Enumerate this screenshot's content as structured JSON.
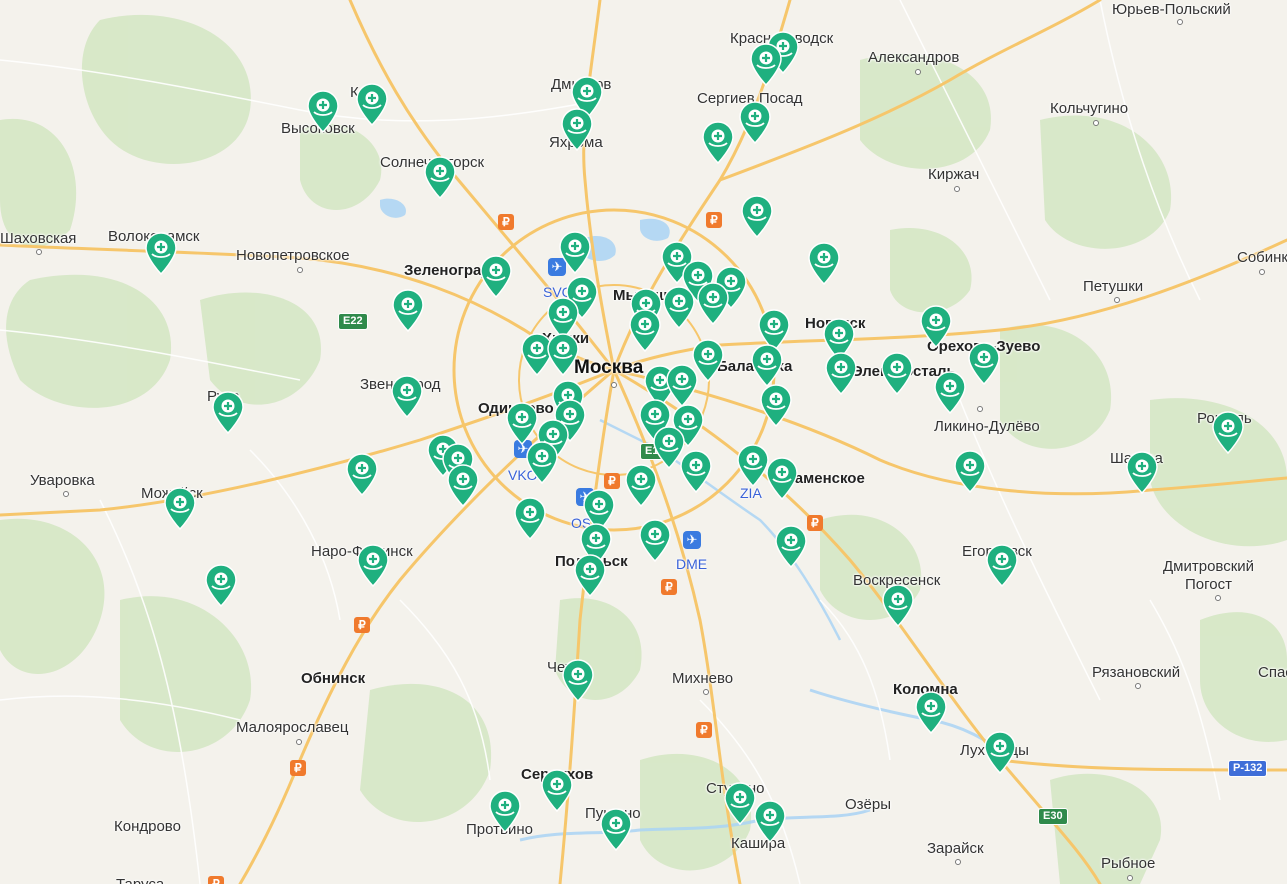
{
  "map": {
    "region": "Московская область",
    "colors": {
      "background": "#f4f2ec",
      "forest": "#d8e9c8",
      "road_major": "#f6c66b",
      "road_minor": "#ffffff",
      "water": "#a9d3f5",
      "pin": "#1fb07f"
    },
    "labels": [
      {
        "id": "yurev-polsky",
        "text": "Юрьев-Польский",
        "style": "normal",
        "dot": true
      },
      {
        "id": "krasnozavodsk",
        "text": "Краснозаводск",
        "style": "normal",
        "dot": false
      },
      {
        "id": "aleksandrov",
        "text": "Александров",
        "style": "normal",
        "dot": true
      },
      {
        "id": "dmitrov",
        "text": "Дмитров",
        "style": "normal",
        "dot": false
      },
      {
        "id": "klin",
        "text": "Клин",
        "style": "normal",
        "dot": false
      },
      {
        "id": "sergiev-posad",
        "text": "Сергиев Посад",
        "style": "normal",
        "dot": false
      },
      {
        "id": "kolchugino",
        "text": "Кольчугино",
        "style": "normal",
        "dot": true
      },
      {
        "id": "vysokovsk",
        "text": "Высоковск",
        "style": "normal",
        "dot": false
      },
      {
        "id": "yakhroma",
        "text": "Яхрома",
        "style": "normal",
        "dot": false
      },
      {
        "id": "solnechnogorsk",
        "text": "Солнечногорск",
        "style": "normal",
        "dot": false
      },
      {
        "id": "kirzhach",
        "text": "Киржач",
        "style": "normal",
        "dot": true
      },
      {
        "id": "shakhovskaya",
        "text": "Шаховская",
        "style": "normal",
        "dot": true
      },
      {
        "id": "volokolamsk",
        "text": "Волоколамск",
        "style": "normal",
        "dot": false
      },
      {
        "id": "novopetrovskoe",
        "text": "Новопетровское",
        "style": "normal",
        "dot": true
      },
      {
        "id": "zelenograd",
        "text": "Зеленоград",
        "style": "bold",
        "dot": false
      },
      {
        "id": "sobinka",
        "text": "Собинка",
        "style": "normal",
        "dot": true
      },
      {
        "id": "petushki",
        "text": "Петушки",
        "style": "normal",
        "dot": true
      },
      {
        "id": "mytishchi",
        "text": "Мытищи",
        "style": "bold",
        "dot": false
      },
      {
        "id": "noginsk",
        "text": "Ногинск",
        "style": "bold",
        "dot": false
      },
      {
        "id": "khimki",
        "text": "Химки",
        "style": "bold",
        "dot": false
      },
      {
        "id": "orekhovo-zuevo",
        "text": "Орехово-Зуево",
        "style": "bold",
        "dot": false
      },
      {
        "id": "moskva",
        "text": "Москва",
        "style": "capital",
        "dot": true
      },
      {
        "id": "balashikha",
        "text": "Балашиха",
        "style": "bold",
        "dot": false
      },
      {
        "id": "elektrostal",
        "text": "Электросталь",
        "style": "bold",
        "dot": false
      },
      {
        "id": "zvenigorod",
        "text": "Звенигород",
        "style": "normal",
        "dot": false
      },
      {
        "id": "ruza",
        "text": "Руза",
        "style": "normal",
        "dot": false
      },
      {
        "id": "odintsovo",
        "text": "Одинцово",
        "style": "bold",
        "dot": false
      },
      {
        "id": "likino-dulevo",
        "text": "Ликино-Дулёво",
        "style": "normal",
        "dot": true
      },
      {
        "id": "roshal",
        "text": "Рошаль",
        "style": "normal",
        "dot": false
      },
      {
        "id": "uvarovka",
        "text": "Уваровка",
        "style": "normal",
        "dot": true
      },
      {
        "id": "mozhaisk",
        "text": "Можайск",
        "style": "normal",
        "dot": false
      },
      {
        "id": "ramenskoe",
        "text": "Раменское",
        "style": "bold",
        "dot": false
      },
      {
        "id": "shatura",
        "text": "Шатура",
        "style": "normal",
        "dot": false
      },
      {
        "id": "naro-fominsk",
        "text": "Наро-Фоминск",
        "style": "normal",
        "dot": false
      },
      {
        "id": "podolsk",
        "text": "Подольск",
        "style": "bold",
        "dot": false
      },
      {
        "id": "egorevsk",
        "text": "Егорьевск",
        "style": "normal",
        "dot": false
      },
      {
        "id": "voskresensk",
        "text": "Воскресенск",
        "style": "normal",
        "dot": false
      },
      {
        "id": "dmitrovsky-pogost",
        "text": "Дмитровский\nПогост",
        "style": "normal",
        "dot": true
      },
      {
        "id": "obninsk",
        "text": "Обнинск",
        "style": "bold",
        "dot": false
      },
      {
        "id": "chekhov",
        "text": "Чехов",
        "style": "normal",
        "dot": false
      },
      {
        "id": "mikhnevo",
        "text": "Михнево",
        "style": "normal",
        "dot": true
      },
      {
        "id": "ryazanovsky",
        "text": "Рязановский",
        "style": "normal",
        "dot": true
      },
      {
        "id": "spas",
        "text": "Спас",
        "style": "normal",
        "dot": false
      },
      {
        "id": "kolomna",
        "text": "Коломна",
        "style": "bold",
        "dot": false
      },
      {
        "id": "maloyaroslavets",
        "text": "Малоярославец",
        "style": "normal",
        "dot": true
      },
      {
        "id": "lukhovitsy",
        "text": "Луховицы",
        "style": "normal",
        "dot": false
      },
      {
        "id": "serpukhov",
        "text": "Серпухов",
        "style": "bold",
        "dot": false
      },
      {
        "id": "stupino",
        "text": "Ступино",
        "style": "normal",
        "dot": false
      },
      {
        "id": "ozery",
        "text": "Озёры",
        "style": "normal",
        "dot": false
      },
      {
        "id": "kondrovo",
        "text": "Кондрово",
        "style": "normal",
        "dot": false
      },
      {
        "id": "protvino",
        "text": "Протвино",
        "style": "normal",
        "dot": false
      },
      {
        "id": "pushchino",
        "text": "Пущино",
        "style": "normal",
        "dot": false
      },
      {
        "id": "kashira",
        "text": "Кашира",
        "style": "normal",
        "dot": false
      },
      {
        "id": "zaraysk",
        "text": "Зарайск",
        "style": "normal",
        "dot": true
      },
      {
        "id": "rybnoe",
        "text": "Рыбное",
        "style": "normal",
        "dot": true
      },
      {
        "id": "tarusa",
        "text": "Таруса",
        "style": "normal",
        "dot": false
      },
      {
        "id": "svo",
        "text": "SVO",
        "style": "airport",
        "dot": false
      },
      {
        "id": "vko",
        "text": "VKO",
        "style": "airport",
        "dot": false
      },
      {
        "id": "ost",
        "text": "OST",
        "style": "airport",
        "dot": false
      },
      {
        "id": "dme",
        "text": "DME",
        "style": "airport",
        "dot": false
      },
      {
        "id": "zia",
        "text": "ZIA",
        "style": "airport",
        "dot": false
      }
    ],
    "road_shields": [
      {
        "id": "e22",
        "text": "E22",
        "color": "green"
      },
      {
        "id": "e101",
        "text": "E101",
        "color": "green"
      },
      {
        "id": "e30",
        "text": "E30",
        "color": "green"
      },
      {
        "id": "p132",
        "text": "Р-132",
        "color": "blue"
      }
    ],
    "fuel_icon": "ruble-fuel-icon",
    "fuel_symbol": "₽",
    "airport_icon": "airplane-icon",
    "airport_symbol": "✈",
    "pin_icon": "clinic-pin-icon",
    "pin_count": 78
  }
}
